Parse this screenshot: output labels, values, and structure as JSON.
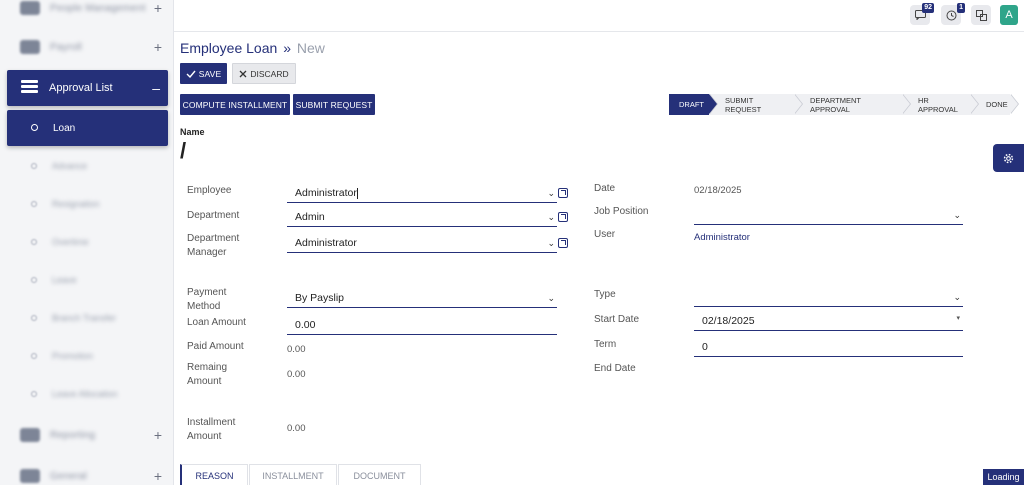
{
  "sidebar": {
    "groups": [
      {
        "label": "People Management",
        "expanded": false
      },
      {
        "label": "Payroll",
        "expanded": false
      },
      {
        "label": "Approval List",
        "expanded": true
      },
      {
        "label": "Reporting",
        "expanded": false
      },
      {
        "label": "General",
        "expanded": false
      }
    ],
    "active_sub": "Loan",
    "sub_items": [
      "Advance",
      "Resignation",
      "Overtime",
      "Leave",
      "Branch Transfer",
      "Promotion",
      "Leave Allocation"
    ]
  },
  "topbar": {
    "messages_count": "92",
    "activity_count": "1",
    "avatar_letter": "A"
  },
  "header": {
    "breadcrumb_parent": "Employee Loan",
    "breadcrumb_sep": "»",
    "breadcrumb_current": "New",
    "save_label": "SAVE",
    "discard_label": "DISCARD"
  },
  "actions": {
    "compute_label": "COMPUTE INSTALLMENT",
    "submit_label": "SUBMIT REQUEST"
  },
  "status_stages": [
    {
      "label": "DRAFT",
      "active": true
    },
    {
      "label": "SUBMIT REQUEST",
      "active": false
    },
    {
      "label": "DEPARTMENT APPROVAL",
      "active": false
    },
    {
      "label": "HR APPROVAL",
      "active": false
    },
    {
      "label": "DONE",
      "active": false
    }
  ],
  "form": {
    "name_label": "Name",
    "name_value": "/",
    "employee_label": "Employee",
    "employee_value": "Administrator",
    "department_label": "Department",
    "department_value": "Admin",
    "dept_manager_label_1": "Department",
    "dept_manager_label_2": "Manager",
    "dept_manager_value": "Administrator",
    "date_label": "Date",
    "date_value": "02/18/2025",
    "job_position_label": "Job Position",
    "job_position_value": "",
    "user_label": "User",
    "user_value": "Administrator",
    "payment_method_label_1": "Payment",
    "payment_method_label_2": "Method",
    "payment_method_value": "By Payslip",
    "loan_amount_label": "Loan Amount",
    "loan_amount_value": "0.00",
    "paid_amount_label": "Paid Amount",
    "paid_amount_value": "0.00",
    "remaining_label_1": "Remaing",
    "remaining_label_2": "Amount",
    "remaining_value": "0.00",
    "installment_label_1": "Installment",
    "installment_label_2": "Amount",
    "installment_value": "0.00",
    "type_label": "Type",
    "type_value": "",
    "start_date_label": "Start Date",
    "start_date_value": "02/18/2025",
    "term_label": "Term",
    "term_value": "0",
    "end_date_label": "End Date",
    "end_date_value": ""
  },
  "tabs": [
    "REASON",
    "INSTALLMENT",
    "DOCUMENT"
  ],
  "loading_text": "Loading"
}
